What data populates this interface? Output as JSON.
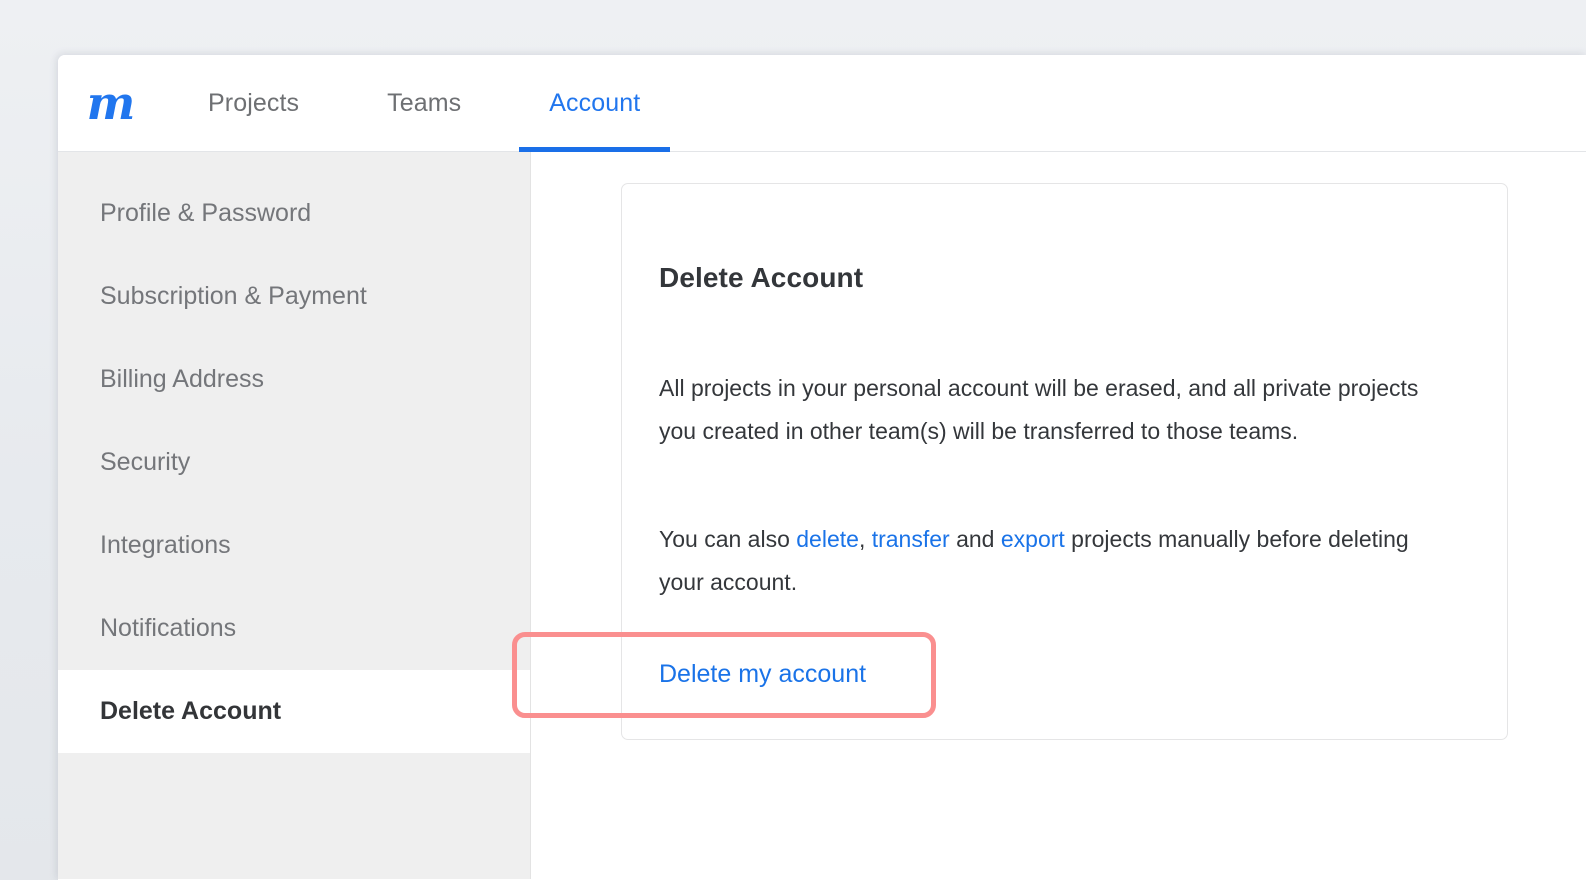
{
  "app": {
    "brand_logo_glyph": "m",
    "brand_color": "#2176ee"
  },
  "top_nav": {
    "tabs": [
      {
        "label": "Projects",
        "active": false
      },
      {
        "label": "Teams",
        "active": false
      },
      {
        "label": "Account",
        "active": true
      }
    ],
    "active_tab_color": "#2176ee",
    "active_underline_color": "#1a6fe8"
  },
  "sidebar": {
    "background": "#efefef",
    "items": [
      {
        "label": "Profile & Password",
        "active": false
      },
      {
        "label": "Subscription & Payment",
        "active": false
      },
      {
        "label": "Billing Address",
        "active": false
      },
      {
        "label": "Security",
        "active": false
      },
      {
        "label": "Integrations",
        "active": false
      },
      {
        "label": "Notifications",
        "active": false
      },
      {
        "label": "Delete Account",
        "active": true
      }
    ]
  },
  "card": {
    "title": "Delete Account",
    "paragraph_one": "All projects in your personal account will be erased, and all private projects you created in other team(s) will be transferred to those teams.",
    "paragraph_two": {
      "prefix": "You can also ",
      "link_delete": "delete",
      "separator_comma": ", ",
      "link_transfer": "transfer",
      "conjunction": " and ",
      "link_export": "export",
      "suffix": " projects manually before deleting your account."
    },
    "delete_link_label": "Delete my account",
    "link_color": "#1a73e8"
  },
  "annotation": {
    "highlight_color": "#fa8f8f",
    "target": "Delete my account"
  }
}
